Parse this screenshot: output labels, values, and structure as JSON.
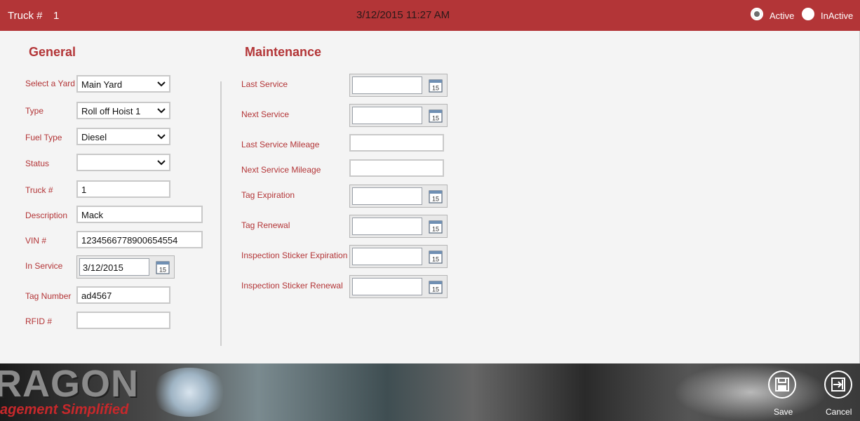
{
  "header": {
    "truck_label": "Truck #",
    "truck_number": "1",
    "datetime": "3/12/2015 11:27 AM",
    "status_options": [
      {
        "label": "Active",
        "selected": true
      },
      {
        "label": "InActive",
        "selected": false
      }
    ]
  },
  "general": {
    "title": "General",
    "yard": {
      "label": "Select a Yard",
      "value": "Main Yard"
    },
    "type": {
      "label": "Type",
      "value": "Roll off Hoist 1"
    },
    "fuel_type": {
      "label": "Fuel Type",
      "value": "Diesel"
    },
    "status": {
      "label": "Status",
      "value": ""
    },
    "truck_no": {
      "label": "Truck #",
      "value": "1"
    },
    "description": {
      "label": "Description",
      "value": "Mack"
    },
    "vin": {
      "label": "VIN #",
      "value": "1234566778900654554"
    },
    "in_service": {
      "label": "In Service",
      "value": "3/12/2015",
      "calendar_day": "15"
    },
    "tag_number": {
      "label": "Tag Number",
      "value": "ad4567"
    },
    "rfid": {
      "label": "RFID #",
      "value": ""
    }
  },
  "maintenance": {
    "title": "Maintenance",
    "last_service": {
      "label": "Last Service",
      "value": ""
    },
    "next_service": {
      "label": "Next Service",
      "value": ""
    },
    "last_service_mileage": {
      "label": "Last Service Mileage",
      "value": ""
    },
    "next_service_mileage": {
      "label": "Next Service Mileage",
      "value": ""
    },
    "tag_expiration": {
      "label": "Tag Expiration",
      "value": ""
    },
    "tag_renewal": {
      "label": "Tag Renewal",
      "value": ""
    },
    "inspection_expiration": {
      "label": "Inspection Sticker Expiration",
      "value": ""
    },
    "inspection_renewal": {
      "label": "Inspection Sticker Renewal",
      "value": ""
    },
    "calendar_day": "15"
  },
  "footer": {
    "brand_text": "RAGON",
    "brand_tagline": "agement Simplified",
    "save_label": "Save",
    "cancel_label": "Cancel"
  },
  "colors": {
    "accent": "#b33537",
    "panel": "#f4f4f4"
  },
  "icons": [
    "calendar-icon",
    "chevron-down-icon",
    "save-icon",
    "exit-icon"
  ]
}
